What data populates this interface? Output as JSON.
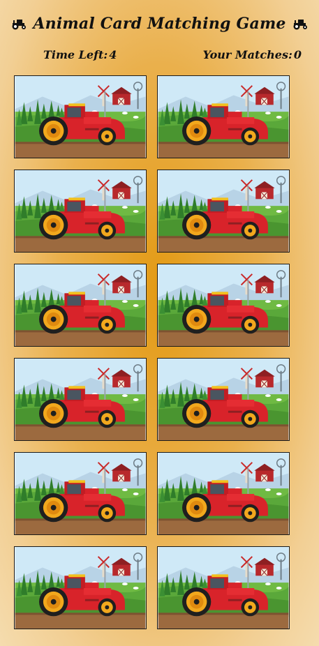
{
  "header": {
    "title": "Animal Card Matching Game",
    "title_icon": "tractor-icon"
  },
  "stats": {
    "time_label": "Time Left:",
    "time_value": "4",
    "matches_label": "Your Matches:",
    "matches_value": "0"
  },
  "board": {
    "rows": 6,
    "columns": 2,
    "card_back": "farm-tractor-illustration",
    "cards": [
      {
        "id": 1,
        "face": "hidden"
      },
      {
        "id": 2,
        "face": "hidden"
      },
      {
        "id": 3,
        "face": "hidden"
      },
      {
        "id": 4,
        "face": "hidden"
      },
      {
        "id": 5,
        "face": "hidden"
      },
      {
        "id": 6,
        "face": "hidden"
      },
      {
        "id": 7,
        "face": "hidden"
      },
      {
        "id": 8,
        "face": "hidden"
      },
      {
        "id": 9,
        "face": "hidden"
      },
      {
        "id": 10,
        "face": "hidden"
      },
      {
        "id": 11,
        "face": "hidden"
      },
      {
        "id": 12,
        "face": "hidden"
      }
    ]
  },
  "colors": {
    "background_center": "#e39a14",
    "background_edge": "#f5dcae",
    "tractor_body": "#d8232a",
    "wheel": "#f2a81d",
    "sky": "#cfe9f7",
    "field": "#5aa83a",
    "dirt": "#9c6a3f"
  }
}
